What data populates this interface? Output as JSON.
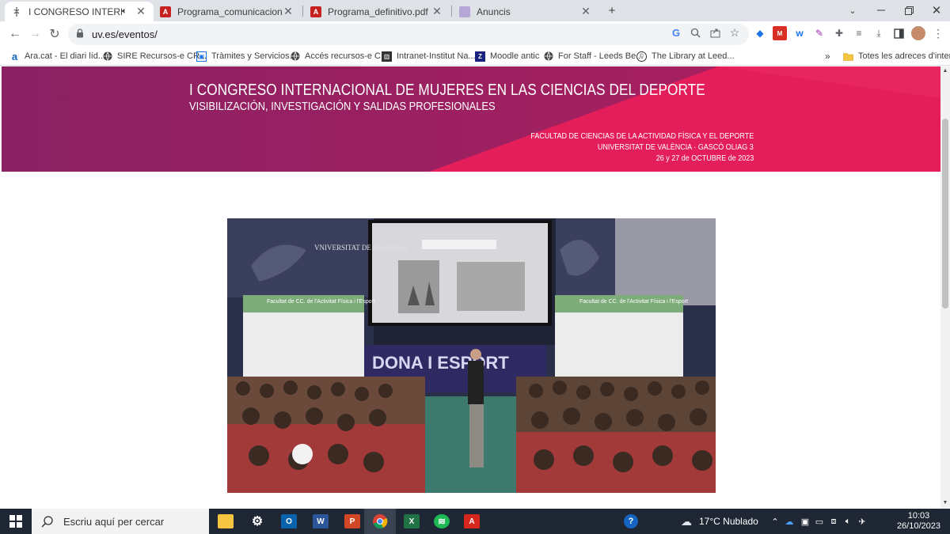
{
  "tabs": [
    {
      "title": "I CONGRESO INTERNACIONAL",
      "favicon": "uv-icon",
      "active": true,
      "audio": true
    },
    {
      "title": "Programa_comunicaciones.pdf",
      "favicon": "pdf-icon",
      "active": false
    },
    {
      "title": "Programa_definitivo.pdf",
      "favicon": "pdf-icon",
      "active": false
    },
    {
      "title": "Anuncis",
      "favicon": "anuncis-icon",
      "active": false
    }
  ],
  "toolbar": {
    "url": "uv.es/eventos/"
  },
  "bookmarks": [
    {
      "label": "Ara.cat - El diari líd...",
      "icon": "ara-icon"
    },
    {
      "label": "SIRE Recursos-e CR...",
      "icon": "globe-icon"
    },
    {
      "label": "Tràmites y Servicios...",
      "icon": "tramites-icon"
    },
    {
      "label": "Accés recursos-e C...",
      "icon": "globe-icon"
    },
    {
      "label": "Intranet-Institut Na...",
      "icon": "intranet-icon"
    },
    {
      "label": "Moodle antic",
      "icon": "moodle-icon"
    },
    {
      "label": "For Staff - Leeds Be...",
      "icon": "globe-icon"
    },
    {
      "label": "The Library at Leed...",
      "icon": "library-icon"
    }
  ],
  "bookmarks_more": "»",
  "bookmarks_folder": "Totes les adreces d'interès",
  "banner": {
    "title": "I CONGRESO INTERNACIONAL DE MUJERES EN LAS CIENCIAS DEL DEPORTE",
    "subtitle": "VISIBILIZACIÓN, INVESTIGACIÓN Y SALIDAS PROFESIONALES",
    "faculty": "FACULTAD DE CIENCIAS DE LA ACTIVIDAD FÍSICA Y EL DEPORTE",
    "university": "UNIVERSITAT DE VALÈNCIA · GASCÓ OLIAG 3",
    "dates": "26 y 27 de OCTUBRE de 2023",
    "colors": {
      "left": "#8d1f63",
      "right": "#e41f5a"
    }
  },
  "photo": {
    "stage_text": "DONA I ESPORT",
    "banner_left": "Facultat de CC. de l'Activitat Física i l'Esport",
    "banner_right": "Facultat de CC. de l'Activitat Física i l'Esport",
    "wall_text": "VNIVERSITAT DE VALÈNCIA"
  },
  "taskbar": {
    "search_placeholder": "Escriu aquí per cercar",
    "weather": "17°C  Nublado",
    "time": "10:03",
    "date": "26/10/2023"
  }
}
